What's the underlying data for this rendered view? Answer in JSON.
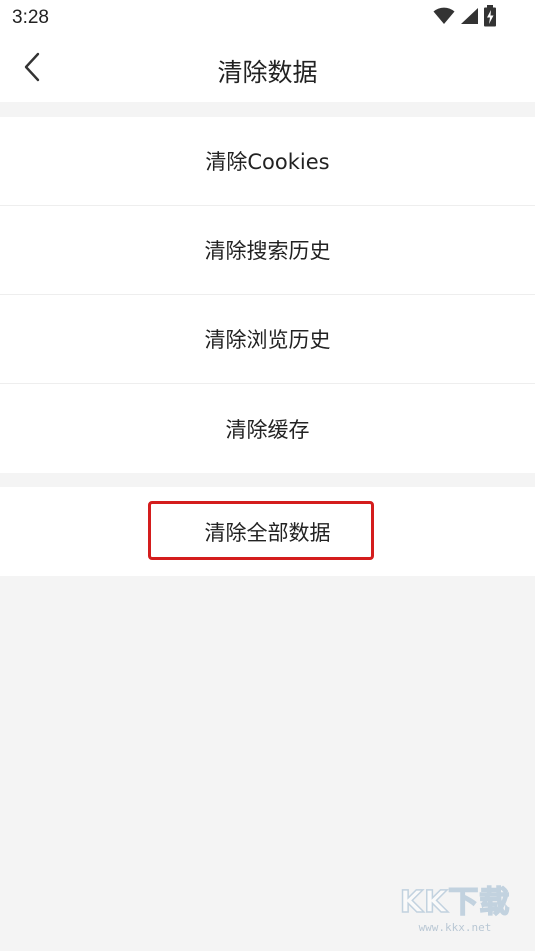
{
  "status_bar": {
    "time": "3:28",
    "icons": [
      "wifi-icon",
      "signal-icon",
      "battery-charging-icon"
    ]
  },
  "header": {
    "title": "清除数据",
    "back_icon": "chevron-left-icon"
  },
  "menu": {
    "items": [
      {
        "label": "清除Cookies"
      },
      {
        "label": "清除搜索历史"
      },
      {
        "label": "清除浏览历史"
      },
      {
        "label": "清除缓存"
      }
    ],
    "clear_all_label": "清除全部数据"
  },
  "watermark": {
    "logo_text": "KK下载",
    "url": "www.kkx.net"
  },
  "colors": {
    "background": "#f4f4f4",
    "surface": "#ffffff",
    "highlight": "#d41d1d",
    "text": "#222222"
  }
}
